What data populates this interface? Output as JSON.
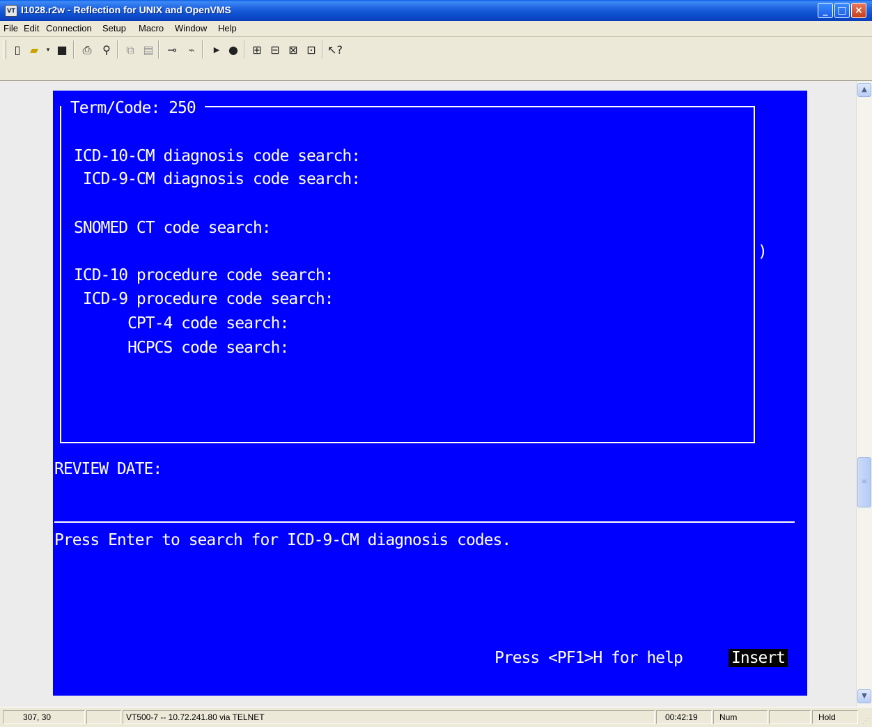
{
  "window": {
    "icon_text": "VT",
    "title": "I1028.r2w - Reflection for UNIX and OpenVMS"
  },
  "menu": [
    "File",
    "Edit",
    "Connection",
    "Setup",
    "Macro",
    "Window",
    "Help"
  ],
  "toolbar": {
    "icons": [
      "new-icon",
      "open-icon",
      "save-icon",
      "print-icon",
      "find-icon",
      "copy-icon",
      "paste-icon",
      "connect-icon",
      "disconnect-icon",
      "play-macro-icon",
      "record-macro-icon",
      "send-file-icon",
      "receive-file-icon",
      "transfer-icon",
      "settings-icon",
      "context-help-icon"
    ]
  },
  "terminal": {
    "box_title": " Term/Code: 250 ",
    "lines": [
      "ICD-10-CM diagnosis code search:",
      " ICD-9-CM diagnosis code search:",
      "SNOMED CT code search:",
      "ICD-10 procedure code search:",
      " ICD-9 procedure code search:",
      "      CPT-4 code search:",
      "      HCPCS code search:"
    ],
    "paren": ")",
    "review_date": "REVIEW DATE:",
    "message": "Press Enter to search for ICD-9-CM diagnosis codes.",
    "help": "Press <PF1>H for help",
    "mode": "Insert"
  },
  "status": {
    "cursor": "307, 30",
    "connection": "VT500-7 -- 10.72.241.80 via TELNET",
    "time": "00:42:19",
    "num": "Num",
    "hold": "Hold"
  },
  "colors": {
    "terminal_bg": "#0000fe",
    "terminal_fg": "#ffffff"
  }
}
